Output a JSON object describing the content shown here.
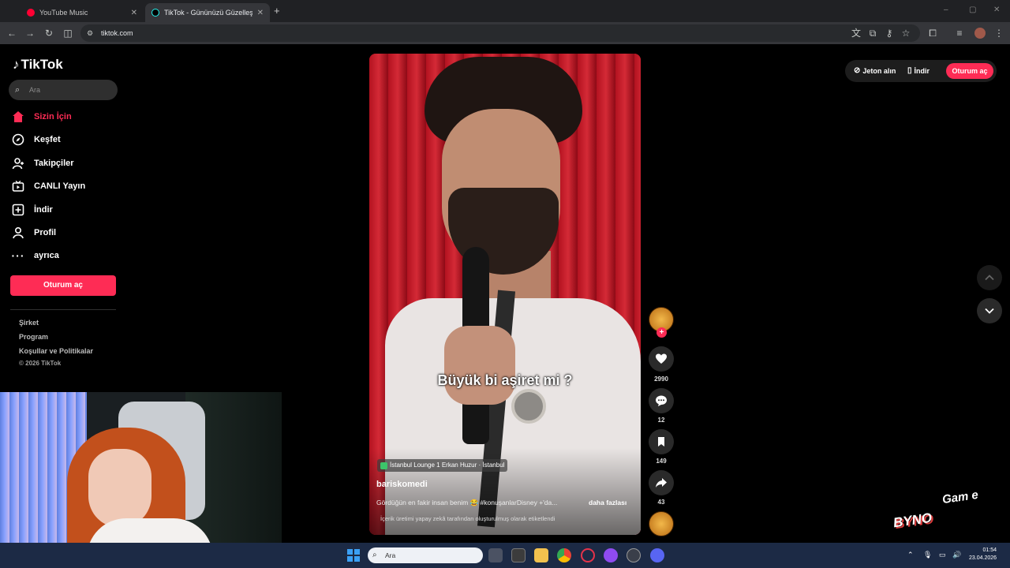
{
  "browser": {
    "tabs": [
      {
        "label": "YouTube Music",
        "icon": "youtube-music-icon",
        "active": false
      },
      {
        "label": "TikTok - Gününüzü Güzelleştirin",
        "icon": "tiktok-icon",
        "active": true
      }
    ],
    "url": "tiktok.com"
  },
  "sidebar": {
    "logo": "TikTok",
    "search_placeholder": "Ara",
    "nav": [
      {
        "label": "Sizin İçin",
        "icon": "home-icon",
        "active": true
      },
      {
        "label": "Keşfet",
        "icon": "compass-icon",
        "active": false
      },
      {
        "label": "Takipçiler",
        "icon": "followers-icon",
        "active": false
      },
      {
        "label": "CANLI Yayın",
        "icon": "live-tv-icon",
        "active": false
      },
      {
        "label": "İndir",
        "icon": "download-icon",
        "active": false
      },
      {
        "label": "Profil",
        "icon": "profile-icon",
        "active": false
      },
      {
        "label": "ayrıca",
        "icon": "more-icon",
        "active": false
      }
    ],
    "login_button": "Oturum aç",
    "footer": [
      "Şirket",
      "Program",
      "Koşullar ve Politikalar"
    ],
    "copyright": "© 2026 TikTok"
  },
  "topbar": {
    "coins": "Jeton alın",
    "download": "İndir",
    "login": "Oturum aç"
  },
  "video": {
    "subtitle": "Büyük bi aşiret mi ?",
    "location": "İstanbul Lounge 1 Erkan Huzur · İstanbul",
    "author": "bariskomedi",
    "caption": "Gördüğün en fakir insan benim 😂 #konuşanlarDisney +'da...",
    "more": "daha fazlası",
    "ai_label": "İçerik üretimi yapay zekâ tarafından oluşturulmuş olarak etiketlendi"
  },
  "actions": {
    "likes": "2990",
    "comments": "12",
    "saves": "149",
    "shares": "43"
  },
  "watermark": {
    "line1": "Gam e",
    "line2": "BYNO"
  },
  "taskbar": {
    "search_placeholder": "Ara",
    "time": "01:54",
    "date": "23.04.2026"
  },
  "colors": {
    "accent": "#fe2c55",
    "background": "#000000",
    "taskbar": "#1c2a45"
  }
}
